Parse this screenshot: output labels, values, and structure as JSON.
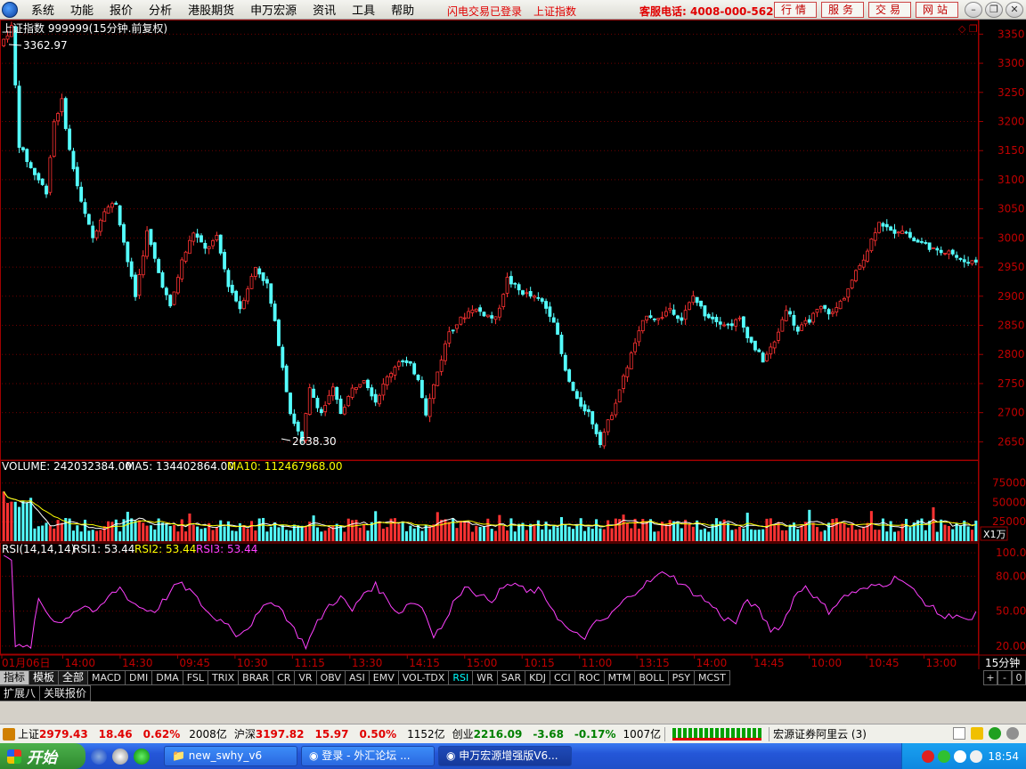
{
  "menu": {
    "items": [
      "系统",
      "功能",
      "报价",
      "分析",
      "港股期货",
      "申万宏源",
      "资讯",
      "工具",
      "帮助"
    ],
    "status_login": "闪电交易已登录",
    "status_symbol": "上证指数",
    "hotline": "客服电话: 4008-000-562",
    "buttons": [
      "行情",
      "服务",
      "交易",
      "网站"
    ]
  },
  "chart_header": {
    "title": "上证指数 999999(15分钟.前复权)",
    "high_label": "3362.97",
    "low_label": "2638.30"
  },
  "volume_header": {
    "volume_label": "VOLUME: 242032384.00",
    "ma5_label": "MA5: 134402864.00",
    "ma10_label": "MA10: 112467968.00",
    "unit_label": "X1万"
  },
  "rsi_header": {
    "name": "RSI(14,14,14)",
    "rsi1": "RSI1: 53.44",
    "rsi2": "RSI2: 53.44",
    "rsi3": "RSI3: 53.44"
  },
  "chart_data": {
    "type": "candlestick",
    "price_axis": {
      "ticks": [
        3350,
        3300,
        3250,
        3200,
        3150,
        3100,
        3050,
        3000,
        2950,
        2900,
        2850,
        2800,
        2750,
        2700,
        2650
      ],
      "range": [
        2620,
        3375
      ]
    },
    "volume_axis": {
      "ticks": [
        75000,
        50000,
        25000
      ],
      "range": [
        0,
        85000
      ]
    },
    "rsi_axis": {
      "ticks": [
        100.0,
        80.0,
        50.0,
        20.0
      ],
      "range": [
        13,
        107
      ]
    },
    "time_labels": [
      "01月06日",
      "14:00",
      "14:30",
      "09:45",
      "10:30",
      "11:15",
      "13:30",
      "14:15",
      "15:00",
      "10:15",
      "11:00",
      "13:15",
      "14:00",
      "14:45",
      "10:00",
      "10:45",
      "13:00"
    ],
    "period_label": "15分钟",
    "price_path": [
      [
        0,
        3330
      ],
      [
        3,
        3362
      ],
      [
        5,
        3160
      ],
      [
        8,
        3120
      ],
      [
        12,
        3080
      ],
      [
        14,
        3200
      ],
      [
        16,
        3235
      ],
      [
        18,
        3150
      ],
      [
        21,
        3060
      ],
      [
        24,
        3000
      ],
      [
        27,
        3050
      ],
      [
        30,
        3060
      ],
      [
        33,
        2960
      ],
      [
        35,
        2900
      ],
      [
        38,
        3010
      ],
      [
        41,
        2940
      ],
      [
        44,
        2880
      ],
      [
        47,
        2960
      ],
      [
        50,
        3010
      ],
      [
        53,
        2980
      ],
      [
        56,
        3000
      ],
      [
        59,
        2920
      ],
      [
        62,
        2880
      ],
      [
        66,
        2950
      ],
      [
        69,
        2920
      ],
      [
        72,
        2820
      ],
      [
        75,
        2700
      ],
      [
        78,
        2650
      ],
      [
        80,
        2740
      ],
      [
        83,
        2700
      ],
      [
        86,
        2740
      ],
      [
        88,
        2700
      ],
      [
        91,
        2740
      ],
      [
        94,
        2760
      ],
      [
        97,
        2720
      ],
      [
        100,
        2760
      ],
      [
        103,
        2790
      ],
      [
        106,
        2780
      ],
      [
        108,
        2760
      ],
      [
        110,
        2700
      ],
      [
        113,
        2770
      ],
      [
        116,
        2840
      ],
      [
        119,
        2860
      ],
      [
        122,
        2880
      ],
      [
        125,
        2870
      ],
      [
        128,
        2860
      ],
      [
        131,
        2930
      ],
      [
        134,
        2910
      ],
      [
        137,
        2900
      ],
      [
        140,
        2890
      ],
      [
        143,
        2860
      ],
      [
        146,
        2770
      ],
      [
        149,
        2720
      ],
      [
        152,
        2700
      ],
      [
        155,
        2650
      ],
      [
        158,
        2700
      ],
      [
        161,
        2760
      ],
      [
        164,
        2820
      ],
      [
        167,
        2870
      ],
      [
        170,
        2860
      ],
      [
        173,
        2880
      ],
      [
        176,
        2860
      ],
      [
        179,
        2900
      ],
      [
        182,
        2870
      ],
      [
        185,
        2860
      ],
      [
        188,
        2850
      ],
      [
        191,
        2860
      ],
      [
        194,
        2820
      ],
      [
        197,
        2790
      ],
      [
        200,
        2820
      ],
      [
        203,
        2880
      ],
      [
        206,
        2840
      ],
      [
        209,
        2860
      ],
      [
        212,
        2880
      ],
      [
        215,
        2870
      ],
      [
        218,
        2900
      ],
      [
        221,
        2940
      ],
      [
        224,
        2980
      ],
      [
        227,
        3030
      ],
      [
        230,
        3010
      ],
      [
        233,
        3015
      ],
      [
        236,
        2995
      ],
      [
        239,
        2990
      ],
      [
        242,
        2975
      ],
      [
        245,
        2980
      ],
      [
        248,
        2960
      ],
      [
        251,
        2960
      ]
    ],
    "rsi_path": [
      [
        0,
        100
      ],
      [
        2,
        96
      ],
      [
        3,
        20
      ],
      [
        5,
        18
      ],
      [
        7,
        20
      ],
      [
        9,
        60
      ],
      [
        12,
        45
      ],
      [
        15,
        40
      ],
      [
        18,
        50
      ],
      [
        21,
        55
      ],
      [
        24,
        48
      ],
      [
        27,
        62
      ],
      [
        30,
        70
      ],
      [
        33,
        58
      ],
      [
        36,
        52
      ],
      [
        39,
        50
      ],
      [
        42,
        62
      ],
      [
        45,
        74
      ],
      [
        48,
        68
      ],
      [
        51,
        56
      ],
      [
        54,
        44
      ],
      [
        57,
        42
      ],
      [
        60,
        30
      ],
      [
        63,
        36
      ],
      [
        66,
        48
      ],
      [
        69,
        60
      ],
      [
        72,
        50
      ],
      [
        75,
        34
      ],
      [
        78,
        20
      ],
      [
        81,
        40
      ],
      [
        84,
        55
      ],
      [
        87,
        62
      ],
      [
        90,
        50
      ],
      [
        93,
        66
      ],
      [
        96,
        72
      ],
      [
        99,
        60
      ],
      [
        102,
        48
      ],
      [
        105,
        58
      ],
      [
        108,
        54
      ],
      [
        111,
        30
      ],
      [
        114,
        40
      ],
      [
        117,
        64
      ],
      [
        120,
        72
      ],
      [
        123,
        62
      ],
      [
        126,
        60
      ],
      [
        129,
        70
      ],
      [
        132,
        74
      ],
      [
        135,
        66
      ],
      [
        138,
        68
      ],
      [
        141,
        56
      ],
      [
        144,
        40
      ],
      [
        147,
        30
      ],
      [
        150,
        28
      ],
      [
        153,
        40
      ],
      [
        156,
        44
      ],
      [
        159,
        55
      ],
      [
        162,
        64
      ],
      [
        165,
        72
      ],
      [
        168,
        78
      ],
      [
        171,
        84
      ],
      [
        174,
        76
      ],
      [
        177,
        68
      ],
      [
        180,
        62
      ],
      [
        183,
        54
      ],
      [
        186,
        44
      ],
      [
        189,
        40
      ],
      [
        192,
        60
      ],
      [
        195,
        50
      ],
      [
        198,
        34
      ],
      [
        201,
        38
      ],
      [
        204,
        62
      ],
      [
        207,
        72
      ],
      [
        210,
        60
      ],
      [
        213,
        50
      ],
      [
        216,
        60
      ],
      [
        219,
        66
      ],
      [
        222,
        68
      ],
      [
        225,
        72
      ],
      [
        228,
        74
      ],
      [
        231,
        80
      ],
      [
        234,
        70
      ],
      [
        237,
        60
      ],
      [
        240,
        52
      ],
      [
        243,
        44
      ],
      [
        246,
        48
      ],
      [
        249,
        40
      ],
      [
        252,
        52
      ]
    ]
  },
  "indicator_tabs": {
    "left": [
      "指标",
      "模板",
      "全部"
    ],
    "items": [
      "MACD",
      "DMI",
      "DMA",
      "FSL",
      "TRIX",
      "BRAR",
      "CR",
      "VR",
      "OBV",
      "ASI",
      "EMV",
      "VOL-TDX",
      "RSI",
      "WR",
      "SAR",
      "KDJ",
      "CCI",
      "ROC",
      "MTM",
      "BOLL",
      "PSY",
      "MCST"
    ],
    "active": "RSI",
    "tools": [
      "+",
      "-",
      "0"
    ]
  },
  "ext_tabs": [
    "扩展八",
    "关联报价"
  ],
  "status": {
    "sh_label": "上证",
    "sh_value": "2979.43",
    "sh_change": "18.46",
    "sh_pct": "0.62%",
    "sh_amount": "2008亿",
    "hs_label": "沪深",
    "hs_value": "3197.82",
    "hs_change": "15.97",
    "hs_pct": "0.50%",
    "hs_amount": "1152亿",
    "cy_label": "创业",
    "cy_value": "2216.09",
    "cy_change": "-3.68",
    "cy_pct": "-0.17%",
    "cy_amount": "1007亿",
    "broker": "宏源证券阿里云 (3)"
  },
  "taskbar": {
    "start": "开始",
    "tasks": [
      "new_swhy_v6",
      "登录 - 外汇论坛 ...",
      "申万宏源增强版V6..."
    ],
    "clock": "18:54"
  }
}
